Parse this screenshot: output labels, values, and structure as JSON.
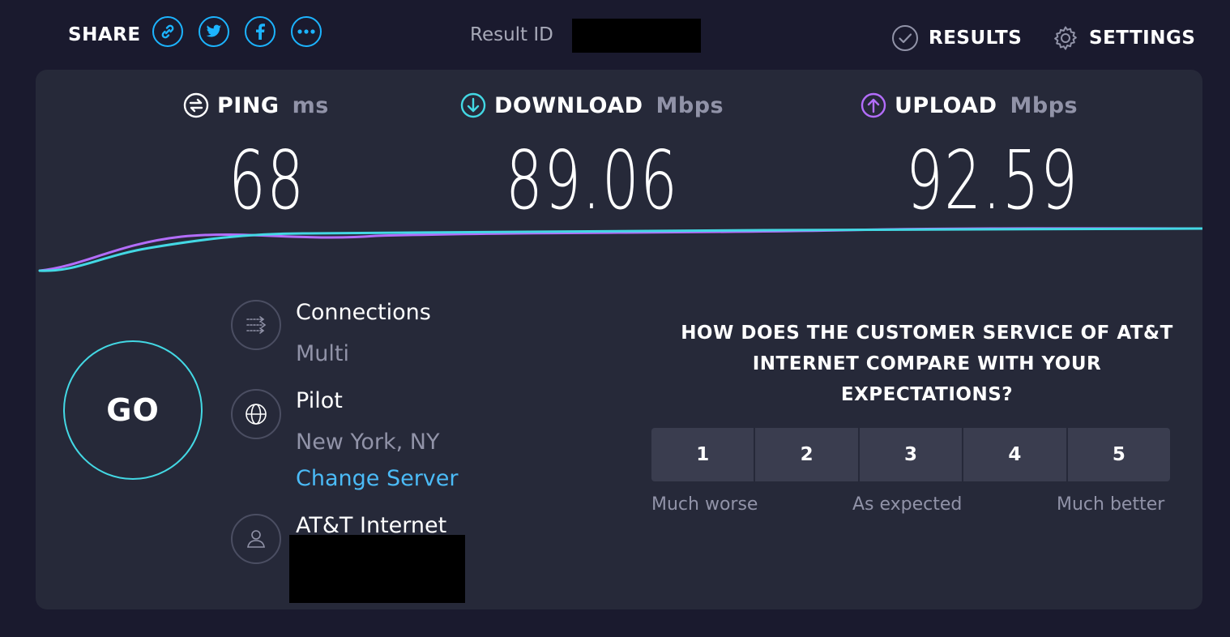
{
  "topbar": {
    "share_label": "SHARE",
    "share_buttons": [
      {
        "icon": "link-icon"
      },
      {
        "icon": "twitter-icon"
      },
      {
        "icon": "facebook-icon"
      },
      {
        "icon": "more-icon"
      }
    ],
    "result_id_label": "Result ID",
    "results_label": "RESULTS",
    "settings_label": "SETTINGS"
  },
  "metrics": {
    "ping": {
      "label": "PING",
      "unit": "ms",
      "value": "68",
      "icon": "ping-icon"
    },
    "download": {
      "label": "DOWNLOAD",
      "unit": "Mbps",
      "value": "89.06",
      "icon": "download-icon"
    },
    "upload": {
      "label": "UPLOAD",
      "unit": "Mbps",
      "value": "92.59",
      "icon": "upload-icon"
    }
  },
  "go_label": "GO",
  "connections": {
    "title": "Connections",
    "value": "Multi",
    "icon": "connections-icon"
  },
  "server": {
    "title": "Pilot",
    "location": "New York, NY",
    "change_label": "Change Server",
    "icon": "globe-icon"
  },
  "provider": {
    "title": "AT&T Internet",
    "icon": "user-icon"
  },
  "survey": {
    "question_lines": [
      "HOW DOES THE CUSTOMER SERVICE OF AT&T",
      "INTERNET COMPARE WITH YOUR",
      "EXPECTATIONS?"
    ],
    "options": [
      "1",
      "2",
      "3",
      "4",
      "5"
    ],
    "scale_low": "Much worse",
    "scale_mid": "As expected",
    "scale_high": "Much better"
  },
  "colors": {
    "background": "#1a1a2e",
    "card": "#262939",
    "accent_blue": "#1cb4ff",
    "download": "#43d8e4",
    "upload": "#b36dfb",
    "link": "#4bbbf7",
    "muted": "#9193a8"
  }
}
